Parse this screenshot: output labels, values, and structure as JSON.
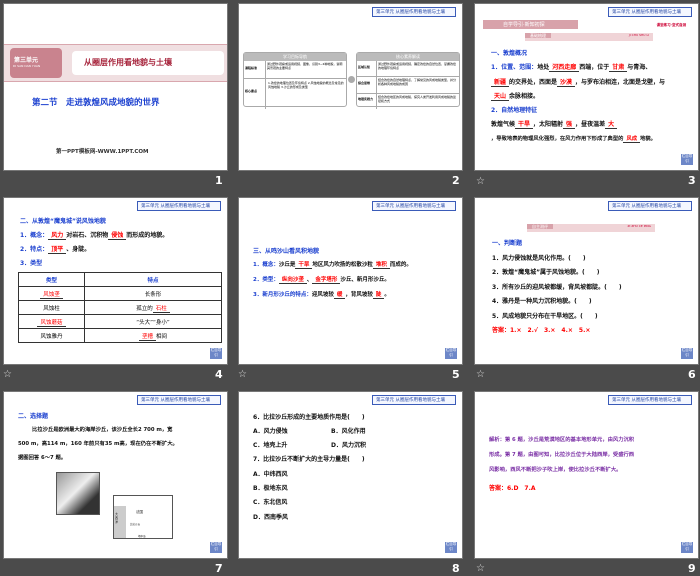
{
  "header_badge": "第三单元  从圈层作用看地貌与土壤",
  "nav_button": "栏目导引",
  "slides": [
    {
      "number": "1",
      "unit_label": "第三单元",
      "unit_pinyin": "DI SAN DAN YUAN",
      "unit_title": "从圈层作用看地貌与土壤",
      "section_title": "第二节　走进敦煌风成地貌的世界",
      "footer": "第一PPT模板网-WWW.1PPT.COM"
    },
    {
      "number": "2",
      "left_title": "学习目标导航",
      "right_title": "核心素养解读",
      "left_rows": [
        {
          "label": "课程标准",
          "text": "通过野外观察或运用视频、图像，识别3~4种地貌，说明其景观的主要特点"
        },
        {
          "label": "核心要点",
          "text": "1.敦煌的地理位置及环境特点 2.风蚀地貌的概念及常见的风蚀地貌 3.沙丘的形成及类型"
        }
      ],
      "right_rows": [
        {
          "label": "区域认知",
          "text": "通过野外观察或运用视频，确定敦煌的自然位置，掌握敦煌的地理环境特点"
        },
        {
          "label": "综合思维",
          "text": "结合敦煌的自然地理特点，了解常见的风成地貌类型，并分析各种风成地貌的成因"
        },
        {
          "label": "地理实践力",
          "text": "结合敦煌地区的风成地貌，探究人类开发利用风成地貌的途径和方式"
        }
      ]
    },
    {
      "number": "3",
      "banner": "自学导引·新知初探",
      "banner_right": "课堂练习·变式自测",
      "sub_banner": "基础梳理",
      "sub_pinyin": "JI CHU SHU LI",
      "h1": "一、敦煌概况",
      "p1_label": "1．位置、范围：",
      "p1a": "地处",
      "b1": "河西走廊",
      "p1b": "西端，位于",
      "b2": "甘肃",
      "p1c": "与青海、",
      "b3": "新疆",
      "p1d": "的交界处，西面是",
      "b4": "沙漠",
      "p1e": "，与罗布泊相连，北面是戈壁，与",
      "b5": "天山",
      "p1f": "余脉相接。",
      "h2": "2．自然地理特征",
      "p2a": "敦煌气候",
      "b6": "干旱",
      "p2b": "，太阳辐射",
      "b7": "强",
      "p2c": "，昼夜温差",
      "b8": "大",
      "p2d": "，导致地表的物理风化强烈，在风力作用下形成了典型的",
      "b9": "风成",
      "p2e": "地貌。"
    },
    {
      "number": "4",
      "h1": "二、从敦煌“魔鬼城”说风蚀地貌",
      "p1a": "1．概念：",
      "b1": "风力",
      "p1b": "对岩石、沉积物",
      "b2": "侵蚀",
      "p1c": "而形成的地貌。",
      "p2a": "2．特点：",
      "b3": "顶平",
      "p2b": "、身陡。",
      "p3": "3．类型",
      "table_headers": [
        "类型",
        "特点"
      ],
      "table_rows": [
        {
          "type": "风蚀垄",
          "feature": "长条形",
          "type_red": true
        },
        {
          "type": "风蚀柱",
          "feature_a": "孤立的",
          "feature_b": "石柱"
        },
        {
          "type": "风蚀蘑菇",
          "feature": "“头大”“身小”",
          "type_red": true
        },
        {
          "type": "风蚀雅丹",
          "feature_b": "垄槽",
          "feature_a": "相间"
        }
      ]
    },
    {
      "number": "5",
      "h1": "三、从鸣沙山看风积地貌",
      "p1a": "1．概念：",
      "p1b": "沙丘是",
      "b1": "干旱",
      "p1c": "地区风力吹扬的松散沙粒",
      "b2": "堆积",
      "p1d": "而成的。",
      "p2a": "2．类型：",
      "b3": "纵向沙垄",
      "p2b": "、",
      "b4": "金字塔形",
      "p2c": "沙丘、新月形沙丘。",
      "p3a": "3．新月形沙丘的特点：",
      "p3b": "迎风坡较",
      "b5": "缓",
      "p3c": "，背风坡较",
      "b6": "陡",
      "p3d": "。"
    },
    {
      "number": "6",
      "banner": "自主测评",
      "sub_pinyin": "ZI ZHU CE PING",
      "h1": "一、判断题",
      "items": [
        "1．风力侵蚀就是风化作用。(　　)",
        "2．敦煌“魔鬼城”属于风蚀地貌。(　　)",
        "3．所有沙丘的迎风坡都缓，背风坡都陡。(　　)",
        "4．雅丹是一种风力沉积地貌。(　　)",
        "5．风成地貌只分布在干旱地区。(　　)"
      ],
      "answer": "答案：1.×　2.√　3.×　4.×　5.×"
    },
    {
      "number": "7",
      "h1": "二、选择题",
      "p1": "比拉沙丘是欧洲最大的海岸沙丘，该沙丘全长2 700 m，宽",
      "p2": "500 m，高114 m，160 年前只有35 m高，现在仍在不断扩大。",
      "p3": "据图回答 6～7 题。",
      "map_labels": [
        "法国",
        "大西洋",
        "比拉沙丘",
        "地中海"
      ]
    },
    {
      "number": "8",
      "q6": "6．比拉沙丘形成的主要地质作用是(　　)",
      "q6_opts": [
        "A．风力侵蚀",
        "B．风化作用",
        "C．地壳上升",
        "D．风力沉积"
      ],
      "q7": "7．比拉沙丘不断扩大的主导力量是(　　)",
      "q7_opts": [
        "A．中纬西风",
        "B．极地东风",
        "C．东北信风",
        "D．西南季风"
      ]
    },
    {
      "number": "9",
      "analysis": [
        "解析：第 6 题，沙丘是荒漠地区的基本地形单元，由风力沉积",
        "形成。第 7 题，由图可知，比拉沙丘位于大陆西岸，受盛行西",
        "风影响，西风不断把沙子吹上岸，使比拉沙丘不断扩大。"
      ],
      "answer": "答案：6.D　7.A"
    }
  ],
  "colors": {
    "background": "#4b4b4b",
    "blue": "#1a3fcf",
    "red": "#ff0000",
    "banner_pink": "#c9838e"
  }
}
